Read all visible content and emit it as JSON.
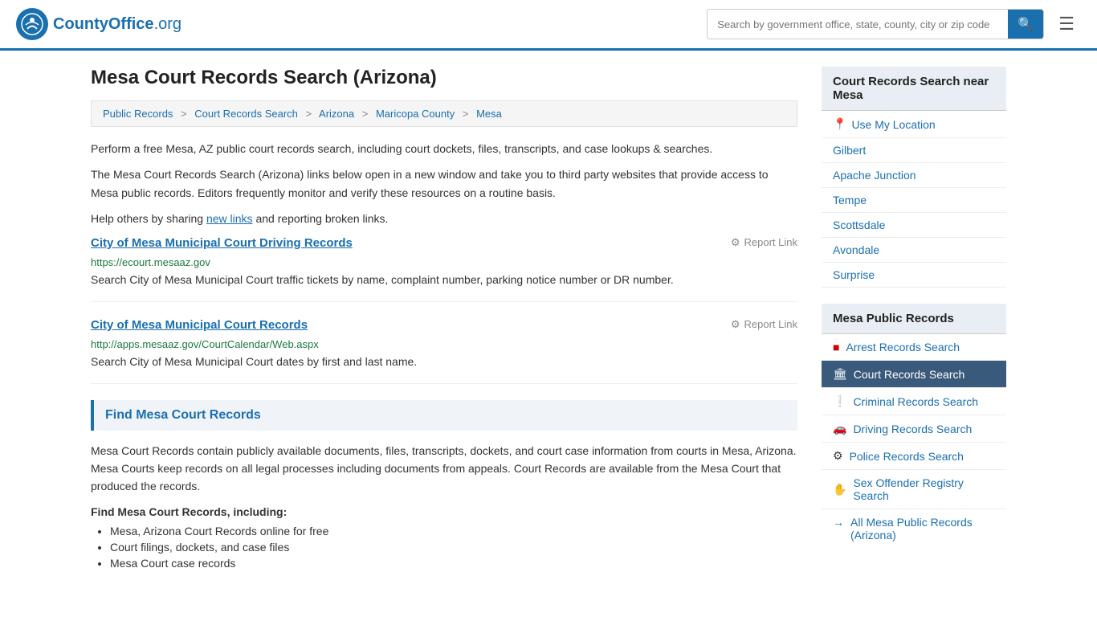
{
  "header": {
    "logo_text": "CountyOffice",
    "logo_org": ".org",
    "search_placeholder": "Search by government office, state, county, city or zip code",
    "search_value": ""
  },
  "page": {
    "title": "Mesa Court Records Search (Arizona)",
    "breadcrumb": [
      {
        "label": "Public Records",
        "href": "#"
      },
      {
        "label": "Court Records Search",
        "href": "#"
      },
      {
        "label": "Arizona",
        "href": "#"
      },
      {
        "label": "Maricopa County",
        "href": "#"
      },
      {
        "label": "Mesa",
        "href": "#"
      }
    ],
    "intro_paragraph1": "Perform a free Mesa, AZ public court records search, including court dockets, files, transcripts, and case lookups & searches.",
    "intro_paragraph2": "The Mesa Court Records Search (Arizona) links below open in a new window and take you to third party websites that provide access to Mesa public records. Editors frequently monitor and verify these resources on a routine basis.",
    "intro_paragraph3_prefix": "Help others by sharing ",
    "intro_new_links": "new links",
    "intro_paragraph3_suffix": " and reporting broken links."
  },
  "resources": [
    {
      "id": "resource-1",
      "title": "City of Mesa Municipal Court Driving Records",
      "url": "https://ecourt.mesaaz.gov",
      "report_label": "Report Link",
      "description": "Search City of Mesa Municipal Court traffic tickets by name, complaint number, parking notice number or DR number."
    },
    {
      "id": "resource-2",
      "title": "City of Mesa Municipal Court Records",
      "url": "http://apps.mesaaz.gov/CourtCalendar/Web.aspx",
      "report_label": "Report Link",
      "description": "Search City of Mesa Municipal Court dates by first and last name."
    }
  ],
  "find_section": {
    "heading": "Find Mesa Court Records",
    "body": "Mesa Court Records contain publicly available documents, files, transcripts, dockets, and court case information from courts in Mesa, Arizona. Mesa Courts keep records on all legal processes including documents from appeals. Court Records are available from the Mesa Court that produced the records.",
    "sub_heading": "Find Mesa Court Records, including:",
    "bullets": [
      "Mesa, Arizona Court Records online for free",
      "Court filings, dockets, and case files",
      "Mesa Court case records"
    ]
  },
  "sidebar": {
    "nearby_title": "Court Records Search near Mesa",
    "use_location_label": "Use My Location",
    "nearby_locations": [
      {
        "label": "Gilbert"
      },
      {
        "label": "Apache Junction"
      },
      {
        "label": "Tempe"
      },
      {
        "label": "Scottsdale"
      },
      {
        "label": "Avondale"
      },
      {
        "label": "Surprise"
      }
    ],
    "public_records_title": "Mesa Public Records",
    "public_records_items": [
      {
        "label": "Arrest Records Search",
        "icon": "■",
        "icon_color": "red",
        "active": false
      },
      {
        "label": "Court Records Search",
        "icon": "🏛",
        "icon_color": "dark",
        "active": true
      },
      {
        "label": "Criminal Records Search",
        "icon": "❗",
        "icon_color": "dark",
        "active": false
      },
      {
        "label": "Driving Records Search",
        "icon": "🚗",
        "icon_color": "dark",
        "active": false
      },
      {
        "label": "Police Records Search",
        "icon": "⚙",
        "icon_color": "dark",
        "active": false
      },
      {
        "label": "Sex Offender Registry Search",
        "icon": "✋",
        "icon_color": "dark",
        "active": false
      }
    ],
    "all_records_label": "All Mesa Public Records (Arizona)",
    "all_records_arrow": "→"
  }
}
